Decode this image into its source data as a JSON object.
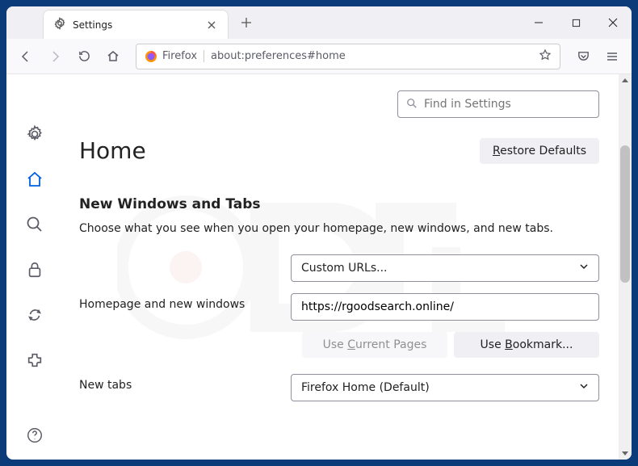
{
  "titlebar": {
    "tab_title": "Settings"
  },
  "urlbar": {
    "identity_label": "Firefox",
    "url": "about:preferences#home"
  },
  "search": {
    "placeholder": "Find in Settings"
  },
  "page": {
    "title": "Home",
    "restore_defaults": "Restore Defaults"
  },
  "section": {
    "title": "New Windows and Tabs",
    "desc": "Choose what you see when you open your homepage, new windows, and new tabs."
  },
  "homepage": {
    "label": "Homepage and new windows",
    "dropdown": "Custom URLs...",
    "value": "https://rgoodsearch.online/",
    "use_current": "Use Current Pages",
    "use_bookmark": "Use Bookmark..."
  },
  "newtabs": {
    "label": "New tabs",
    "dropdown": "Firefox Home (Default)"
  }
}
